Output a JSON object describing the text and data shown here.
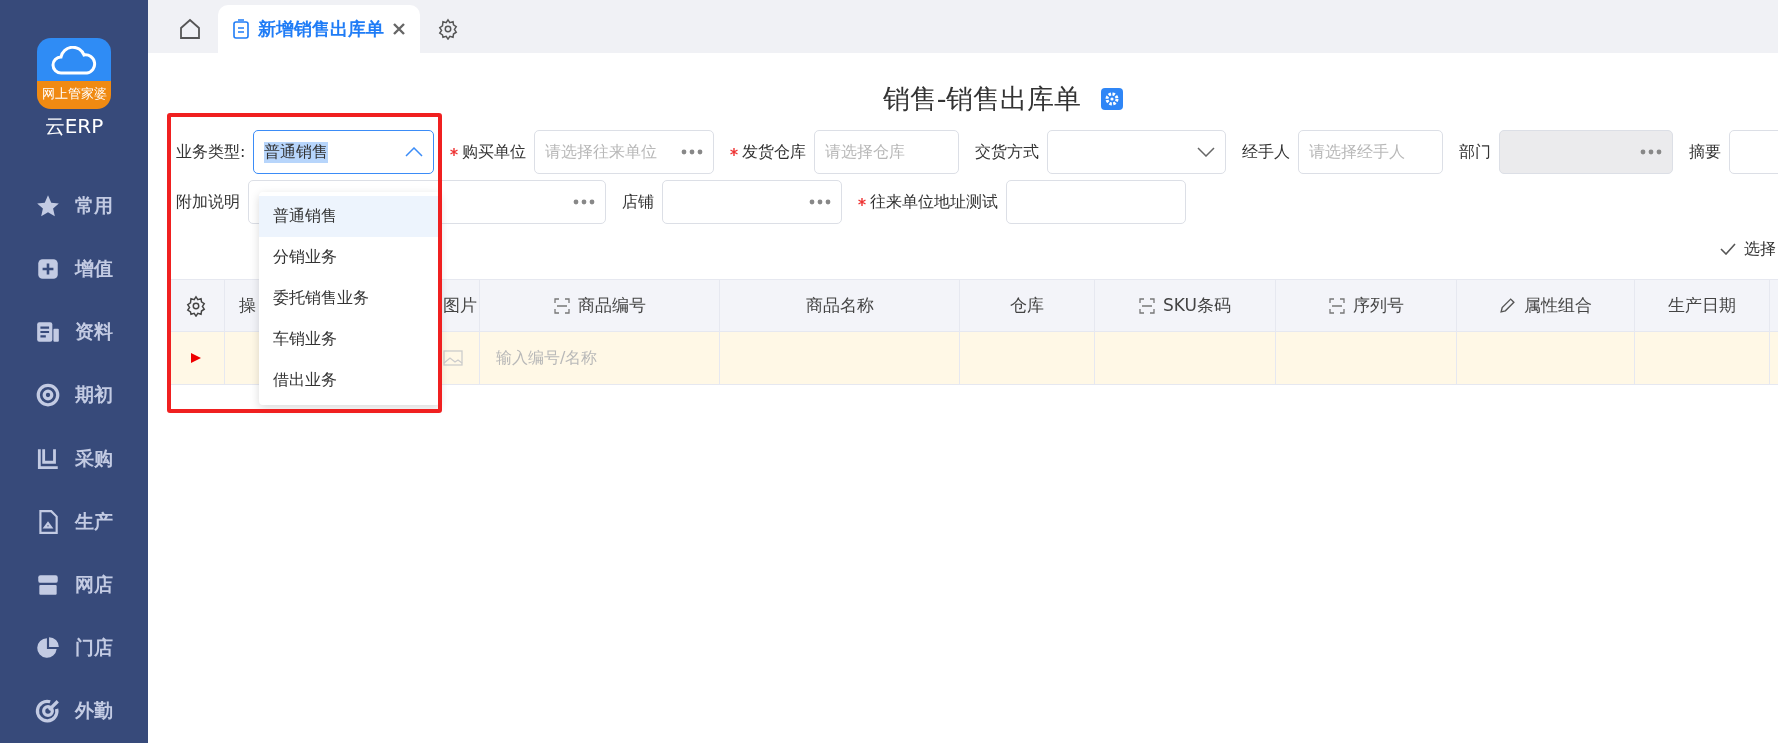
{
  "sidebar": {
    "logo_caption": "网上管家婆",
    "logo_text": "云ERP",
    "items": [
      {
        "label": "常用"
      },
      {
        "label": "增值"
      },
      {
        "label": "资料"
      },
      {
        "label": "期初"
      },
      {
        "label": "采购"
      },
      {
        "label": "生产"
      },
      {
        "label": "网店"
      },
      {
        "label": "门店"
      },
      {
        "label": "外勤"
      }
    ]
  },
  "tabs": [
    {
      "label": "新增销售出库单",
      "selected": true
    }
  ],
  "page_title": "销售-销售出库单",
  "form_row_1": [
    {
      "kind": "select",
      "label": "业务类型:",
      "required": false,
      "value": "普通销售",
      "open": true
    },
    {
      "kind": "picker",
      "label": "购买单位",
      "required": true,
      "placeholder": "请选择往来单位"
    },
    {
      "kind": "input",
      "label": "发货仓库",
      "required": true,
      "placeholder": "请选择仓库"
    },
    {
      "kind": "select",
      "label": "交货方式",
      "required": false,
      "open": false
    },
    {
      "kind": "input",
      "label": "经手人",
      "required": false,
      "placeholder": "请选择经手人"
    },
    {
      "kind": "picker",
      "label": "部门",
      "required": false,
      "disabled": true
    },
    {
      "kind": "input",
      "label": "摘要",
      "required": false
    }
  ],
  "form_row_2": [
    {
      "kind": "picker",
      "label": "附加说明",
      "required": false
    },
    {
      "kind": "picker",
      "label": "店铺",
      "required": false
    },
    {
      "kind": "input",
      "label": "往来单位地址测试",
      "required": true
    }
  ],
  "dropdown": {
    "options": [
      {
        "label": "普通销售",
        "selected": true
      },
      {
        "label": "分销业务",
        "selected": false
      },
      {
        "label": "委托销售业务",
        "selected": false
      },
      {
        "label": "车销业务",
        "selected": false
      },
      {
        "label": "借出业务",
        "selected": false
      }
    ]
  },
  "batch_action": "选择",
  "table": {
    "columns": [
      {
        "kind": "settings"
      },
      {
        "kind": "plain",
        "label": "操"
      },
      {
        "kind": "plain",
        "label": "图片"
      },
      {
        "kind": "scan",
        "label": "商品编号"
      },
      {
        "kind": "plain",
        "label": "商品名称"
      },
      {
        "kind": "plain",
        "label": "仓库"
      },
      {
        "kind": "scan",
        "label": "SKU条码"
      },
      {
        "kind": "scan",
        "label": "序列号"
      },
      {
        "kind": "edit",
        "label": "属性组合"
      },
      {
        "kind": "plain",
        "label": "生产日期"
      }
    ],
    "row": {
      "code_placeholder": "输入编号/名称"
    }
  }
}
